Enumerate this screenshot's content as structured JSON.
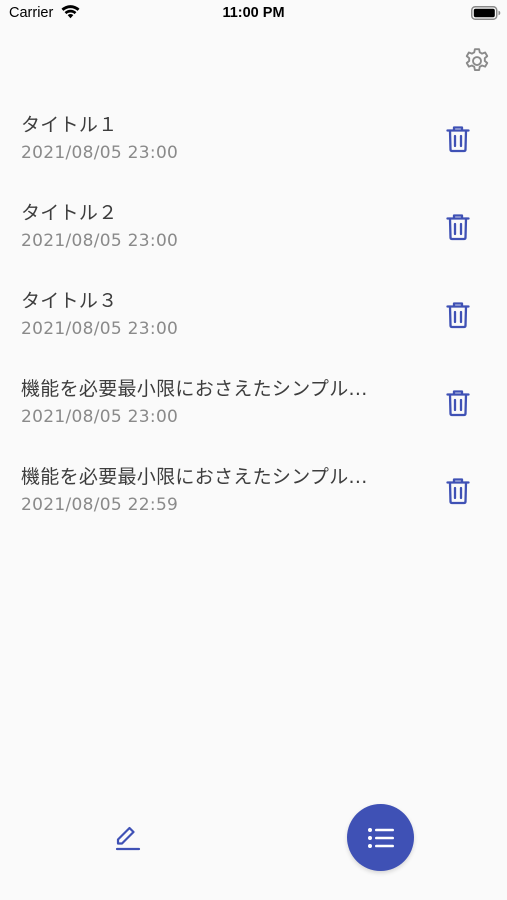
{
  "status_bar": {
    "carrier": "Carrier",
    "time": "11:00 PM",
    "wifi_icon": "wifi-icon",
    "battery_icon": "battery-icon"
  },
  "header": {
    "settings_icon": "gear-icon"
  },
  "memos": [
    {
      "title": "タイトル１",
      "date": "2021/08/05 23:00"
    },
    {
      "title": "タイトル２",
      "date": "2021/08/05 23:00"
    },
    {
      "title": "タイトル３",
      "date": "2021/08/05 23:00"
    },
    {
      "title": "機能を必要最小限におさえたシンプル...",
      "date": "2021/08/05 23:00"
    },
    {
      "title": "機能を必要最小限におさえたシンプル...",
      "date": "2021/08/05 22:59"
    }
  ],
  "actions": {
    "delete_icon": "trash-icon",
    "compose_icon": "pencil-icon",
    "list_icon": "list-icon"
  },
  "colors": {
    "accent": "#3f51b5",
    "background": "#fafafa",
    "title_text": "#3d3d3d",
    "date_text": "#8a8a8a",
    "settings_icon": "#8a8a8a"
  }
}
